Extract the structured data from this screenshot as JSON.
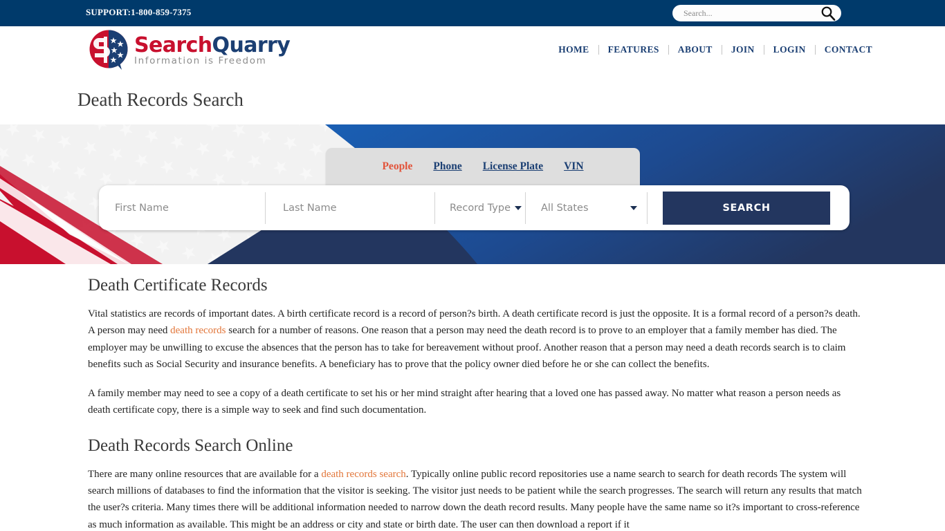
{
  "topbar": {
    "support": "SUPPORT:1-800-859-7375",
    "search_placeholder": "Search...",
    "search_value": "",
    "search_icon": "search-icon"
  },
  "header": {
    "logo": {
      "name_part1": "Search",
      "name_part2": "Quarry",
      "tagline": "Information is Freedom",
      "color_red": "#c8102e",
      "color_blue": "#1b3f73"
    },
    "nav": [
      {
        "label": "HOME"
      },
      {
        "label": "FEATURES"
      },
      {
        "label": "ABOUT"
      },
      {
        "label": "JOIN"
      },
      {
        "label": "LOGIN"
      },
      {
        "label": "CONTACT"
      }
    ]
  },
  "page": {
    "title": "Death Records Search"
  },
  "hero": {
    "tabs": [
      {
        "label": "People",
        "active": true
      },
      {
        "label": "Phone",
        "active": false
      },
      {
        "label": "License Plate",
        "active": false
      },
      {
        "label": "VIN",
        "active": false
      }
    ],
    "form": {
      "first_name_placeholder": "First Name",
      "first_name_value": "",
      "last_name_placeholder": "Last Name",
      "last_name_value": "",
      "record_type_label": "Record Type",
      "state_label": "All States",
      "search_button": "SEARCH"
    },
    "colors": {
      "navy": "#23365f",
      "red": "#c8102e",
      "panel": "#dedede"
    }
  },
  "article": {
    "heading1": "Death Certificate Records",
    "p1_a": "Vital statistics are records of important dates. A birth certificate record is a record of person?s birth. A death certificate record is just the opposite. It is a formal record of a person?s death. A person may need ",
    "p1_link": "death records",
    "p1_b": " search for a number of reasons. One reason that a person may need the death record is to prove to an employer that a family member has died. The employer may be unwilling to excuse the absences that the person has to take for bereavement without proof. Another reason that a person may need a death records search is to claim benefits such as Social Security and insurance benefits. A beneficiary has to prove that the policy owner died before he or she can collect the benefits.",
    "p2": "A family member may need to see a copy of a death certificate to set his or her mind straight after hearing that a loved one has passed away. No matter what reason a person needs as death certificate copy, there is a simple way to seek and find such documentation.",
    "heading2": "Death Records Search Online",
    "p3_a": "There are many online resources that are available for a ",
    "p3_link": "death records search",
    "p3_b": ". Typically online public record repositories use a name search to search for death records The system will search millions of databases to find the information that the visitor is seeking. The visitor just needs to be patient while the search progresses. The search will return any results that match the user?s criteria. Many times there will be additional information needed to narrow down the death record results. Many people have the same name so it?s important to cross-reference as much information as available. This might be an address or city and state or birth date. The user can then download a report if it"
  }
}
